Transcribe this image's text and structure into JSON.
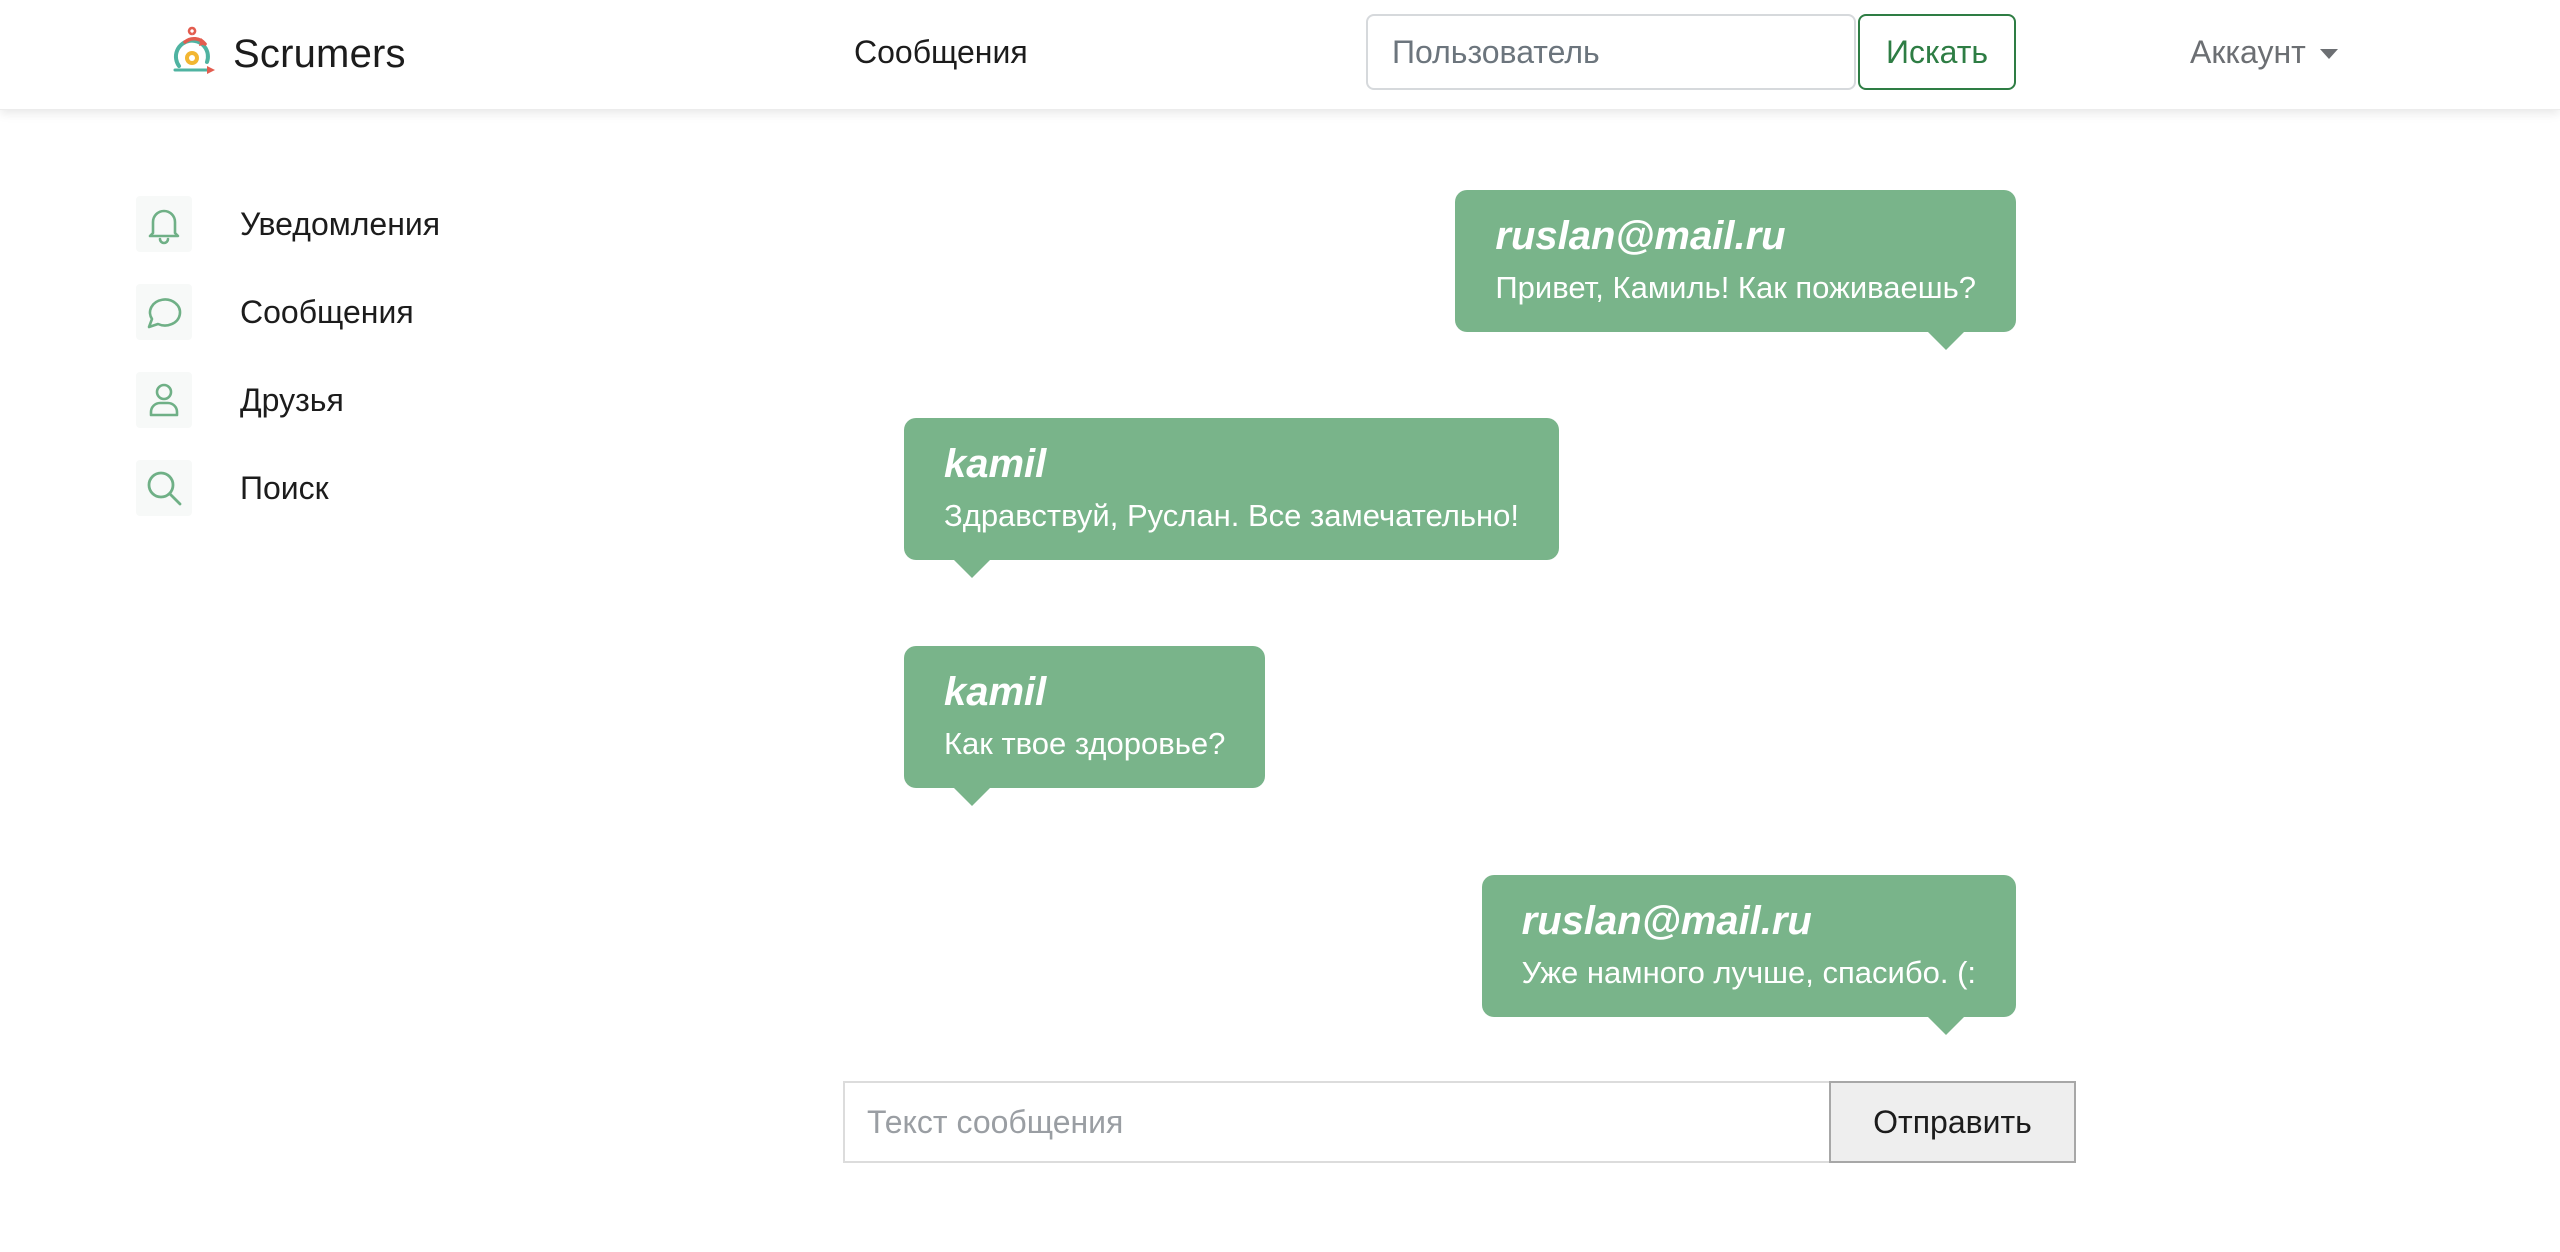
{
  "brand": {
    "name": "Scrumers",
    "logo_icon": "scrum-cycle-logo-icon"
  },
  "nav": {
    "messages_link": "Сообщения",
    "search_placeholder": "Пользователь",
    "search_button": "Искать",
    "account_label": "Аккаунт"
  },
  "sidebar": {
    "items": [
      {
        "label": "Уведомления",
        "icon": "bell-icon"
      },
      {
        "label": "Сообщения",
        "icon": "chat-bubble-icon"
      },
      {
        "label": "Друзья",
        "icon": "person-icon"
      },
      {
        "label": "Поиск",
        "icon": "search-icon"
      }
    ]
  },
  "chat": {
    "messages": [
      {
        "author": "ruslan@mail.ru",
        "text": "Привет, Камиль! Как поживаешь?",
        "side": "right"
      },
      {
        "author": "kamil",
        "text": "Здравствуй, Руслан. Все замечательно!",
        "side": "left"
      },
      {
        "author": "kamil",
        "text": "Как твое здоровье?",
        "side": "left"
      },
      {
        "author": "ruslan@mail.ru",
        "text": "Уже намного лучше, спасибо. (:",
        "side": "right"
      }
    ]
  },
  "compose": {
    "placeholder": "Текст сообщения",
    "send_button": "Отправить"
  },
  "colors": {
    "bubble": "#79b48a",
    "accent": "#2e7d44",
    "icon": "#6fb086"
  }
}
